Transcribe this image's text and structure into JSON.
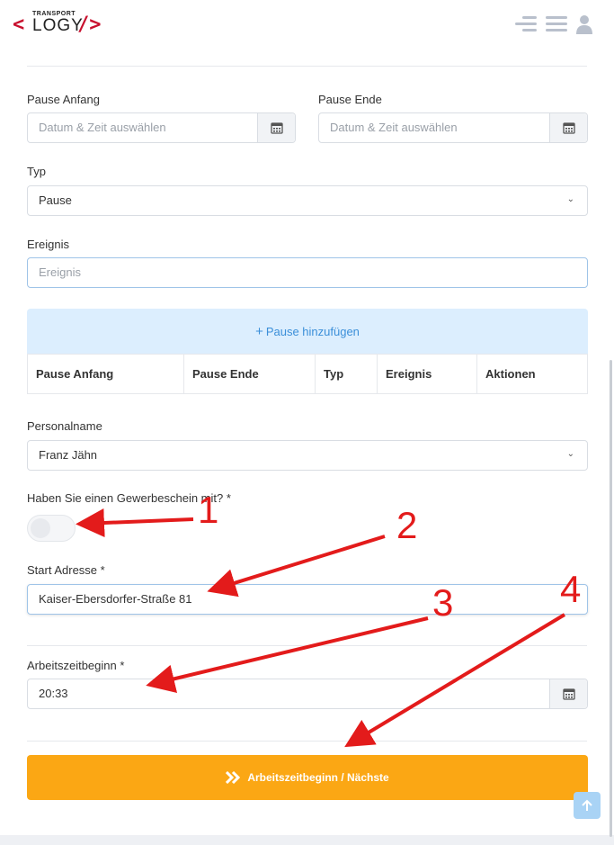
{
  "logo": {
    "top": "TRANSPORT",
    "main": "LOGY",
    "left_bracket": "<",
    "right_bracket": "/>"
  },
  "header_icons": [
    "menu-collapse-icon",
    "menu-icon",
    "user-icon"
  ],
  "pause_anfang": {
    "label": "Pause Anfang",
    "placeholder": "Datum & Zeit auswählen"
  },
  "pause_ende": {
    "label": "Pause Ende",
    "placeholder": "Datum & Zeit auswählen"
  },
  "typ": {
    "label": "Typ",
    "value": "Pause"
  },
  "ereignis": {
    "label": "Ereignis",
    "placeholder": "Ereignis"
  },
  "add_pause": {
    "icon": "+",
    "label": "Pause hinzufügen"
  },
  "table": {
    "columns": [
      "Pause Anfang",
      "Pause Ende",
      "Typ",
      "Ereignis",
      "Aktionen"
    ]
  },
  "personalname": {
    "label": "Personalname",
    "value": "Franz Jähn"
  },
  "gewerbeschein": {
    "label": "Haben Sie einen Gewerbeschein mit? *",
    "checked": false
  },
  "start_adresse": {
    "label": "Start Adresse *",
    "value": "Kaiser-Ebersdorfer-Straße 81"
  },
  "arbeitszeitbeginn": {
    "label": "Arbeitszeitbeginn *",
    "value": "20:33"
  },
  "submit": {
    "label": "Arbeitszeitbeginn / Nächste"
  },
  "annotations": [
    "1",
    "2",
    "3",
    "4"
  ],
  "colors": {
    "accent": "#fba714",
    "annotation": "#e31b1b",
    "add_bar": "#dceefe"
  }
}
